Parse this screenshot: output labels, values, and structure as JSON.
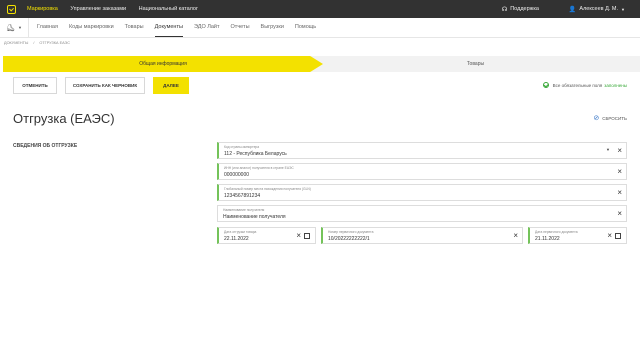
{
  "topbar": {
    "nav": [
      "Маркировка",
      "Управление заказами",
      "Национальный каталог"
    ],
    "support": "Поддержка",
    "user": "Алексеев Д. М."
  },
  "subbar": {
    "nav": [
      "Главная",
      "Коды маркировки",
      "Товары",
      "Документы",
      "ЭДО Лайт",
      "Отчеты",
      "Выгрузки",
      "Помощь"
    ]
  },
  "breadcrumb": [
    "Документы",
    "Отгрузка ЕАЭС"
  ],
  "steps": [
    "Общая информация",
    "Товары"
  ],
  "actions": {
    "cancel": "ОТМЕНИТЬ",
    "save_draft": "СОХРАНИТЬ КАК ЧЕРНОВИК",
    "next": "ДАЛЕЕ"
  },
  "status": {
    "text": "Все обязательные поля",
    "highlight": "заполнены"
  },
  "page_title": "Отгрузка (ЕАЭС)",
  "reset_label": "СБРОСИТЬ",
  "section_title": "СВЕДЕНИЯ ОБ ОТГРУЗКЕ",
  "fields": {
    "country": {
      "label": "Код страны-импортера",
      "value": "112 - Республика Беларусь"
    },
    "inn": {
      "label": "ИНН (или аналог) получателя в стране ЕАЭС",
      "value": "000000000"
    },
    "gln": {
      "label": "Глобальный номер места нахождения получателя (GLN)",
      "value": "1234567891234"
    },
    "recipient": {
      "label": "Наименование получателя",
      "value": "Наименование получателя"
    },
    "ship_date": {
      "label": "Дата отгрузки товара",
      "value": "22.11.2022"
    },
    "doc_number": {
      "label": "Номер первичного документа",
      "value": "10/20222222222/1"
    },
    "doc_date": {
      "label": "Дата первичного документа",
      "value": "21.11.2022"
    }
  },
  "colors": {
    "accent": "#f3e100",
    "topbar": "#323232",
    "success": "#37a837",
    "link": "#3a78c8"
  }
}
